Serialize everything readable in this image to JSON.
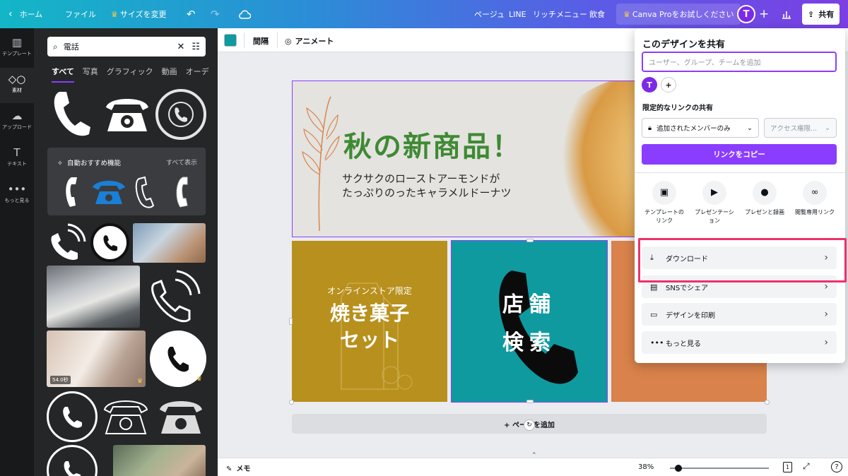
{
  "topbar": {
    "home": "ホーム",
    "file": "ファイル",
    "resize": "サイズを変更",
    "page_label": "ページュ",
    "line": "LINE",
    "rich_menu": "リッチメニュー",
    "food": "飲食",
    "try_pro": "Canva Proをお試しください",
    "avatar": "T",
    "share": "共有"
  },
  "rail": [
    {
      "icon": "template-icon",
      "label": "テンプレート"
    },
    {
      "icon": "elements-icon",
      "label": "素材"
    },
    {
      "icon": "upload-icon",
      "label": "アップロード"
    },
    {
      "icon": "text-icon",
      "label": "テキスト"
    },
    {
      "icon": "more-icon",
      "label": "もっと見る"
    }
  ],
  "panel": {
    "search_value": "電話",
    "tabs": [
      "すべて",
      "写真",
      "グラフィック",
      "動画",
      "オーデ"
    ],
    "auto_title": "自動おすすめ機能",
    "auto_all": "すべて表示",
    "video_duration": "54.0秒"
  },
  "toolbar": {
    "spacing": "間隔",
    "animate": "アニメート",
    "color": "#0f9aa0"
  },
  "design": {
    "headline": "秋の新商品！",
    "sub1": "サクサクのローストアーモンドが",
    "sub2": "たっぷりのったキャラメルドーナツ",
    "tile1_small": "オンラインストア限定",
    "tile1_big1": "焼き菓子",
    "tile1_big2": "セット",
    "tile2_line1": "店舗",
    "tile2_line2": "検索",
    "add_page": "+ ページを追加"
  },
  "bottom": {
    "memo": "メモ",
    "zoom": "38%",
    "zoom_fraction": 0.05,
    "page_count": "1"
  },
  "share": {
    "title": "このデザインを共有",
    "input_placeholder": "ユーザー、グループ、チームを追加",
    "avatar": "T",
    "link_title": "限定的なリンクの共有",
    "link_scope": "追加されたメンバーのみ",
    "access": "アクセス権限...",
    "copy_link": "リンクをコピー",
    "options": [
      {
        "icon": "template-link-icon",
        "glyph": "▣",
        "label1": "テンプレートの",
        "label2": "リンク"
      },
      {
        "icon": "presentation-icon",
        "glyph": "▶",
        "label1": "プレゼンテーシ",
        "label2": "ョン"
      },
      {
        "icon": "record-icon",
        "glyph": "●",
        "label1": "プレゼンと録画",
        "label2": ""
      },
      {
        "icon": "view-link-icon",
        "glyph": "∞",
        "label1": "閲覧専用リンク",
        "label2": ""
      }
    ],
    "rows": [
      {
        "icon": "download-icon",
        "glyph": "⤓",
        "label": "ダウンロード"
      },
      {
        "icon": "social-share-icon",
        "glyph": "▤",
        "label": "SNSでシェア"
      },
      {
        "icon": "print-icon",
        "glyph": "▭",
        "label": "デザインを印刷"
      },
      {
        "icon": "more-dots-icon",
        "glyph": "•••",
        "label": "もっと見る"
      }
    ]
  }
}
